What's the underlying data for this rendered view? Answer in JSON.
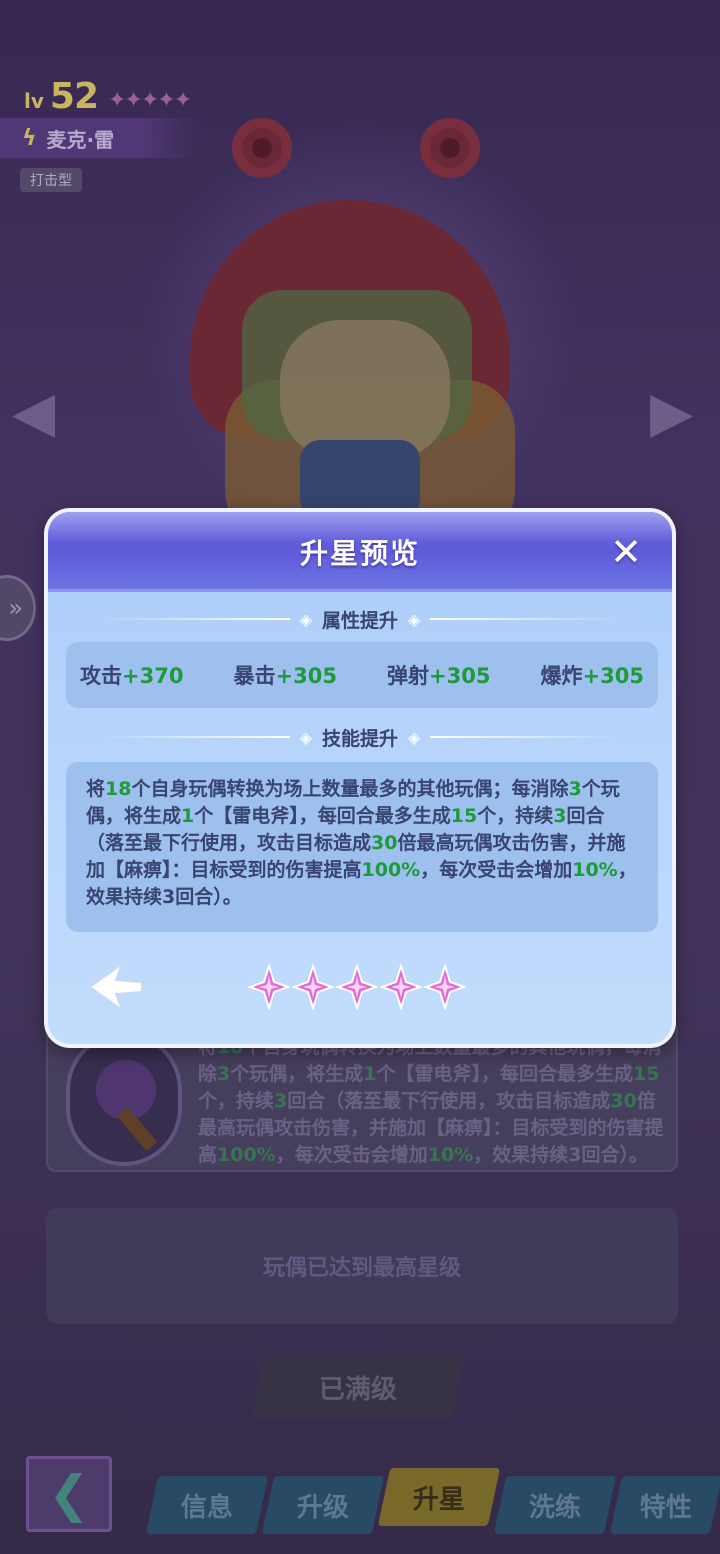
{
  "character": {
    "level_label": "lv",
    "level": "52",
    "name": "麦克·雷",
    "type": "打击型",
    "stars": "✦✦✦✦✦"
  },
  "skill_card": {
    "text_parts": [
      {
        "t": "将",
        "h": false
      },
      {
        "t": "18",
        "h": true
      },
      {
        "t": "个自身玩偶转换为场上数量最多的其他玩偶，每消除",
        "h": false
      },
      {
        "t": "3",
        "h": true
      },
      {
        "t": "个玩偶，将生成",
        "h": false
      },
      {
        "t": "1",
        "h": true
      },
      {
        "t": "个【雷电斧】，每回合最多生成",
        "h": false
      },
      {
        "t": "15",
        "h": true
      },
      {
        "t": "个，持续",
        "h": false
      },
      {
        "t": "3",
        "h": true
      },
      {
        "t": "回合（落至最下行使用，攻击目标造成",
        "h": false
      },
      {
        "t": "30",
        "h": true
      },
      {
        "t": "倍最高玩偶攻击伤害，并施加【麻痹】：目标受到的伤害提高",
        "h": false
      },
      {
        "t": "100%",
        "h": true
      },
      {
        "t": "，每次受击会增加",
        "h": false
      },
      {
        "t": "10%",
        "h": true
      },
      {
        "t": "，效果持续3回合）。",
        "h": false
      }
    ]
  },
  "max_star_text": "玩偶已达到最高星级",
  "max_level_button": "已满级",
  "tabs": [
    {
      "label": "信息",
      "active": false
    },
    {
      "label": "升级",
      "active": false
    },
    {
      "label": "升星",
      "active": true
    },
    {
      "label": "洗练",
      "active": false
    },
    {
      "label": "特性",
      "active": false
    }
  ],
  "modal": {
    "title": "升星预览",
    "close_icon": "close-x-icon",
    "attr_section": "属性提升",
    "attributes": [
      {
        "name": "攻击",
        "value": "+370"
      },
      {
        "name": "暴击",
        "value": "+305"
      },
      {
        "name": "弹射",
        "value": "+305"
      },
      {
        "name": "爆炸",
        "value": "+305"
      }
    ],
    "skill_section": "技能提升",
    "skill_parts": [
      {
        "t": "将",
        "h": false
      },
      {
        "t": "18",
        "h": true
      },
      {
        "t": "个自身玩偶转换为场上数量最多的其他玩偶；每消除",
        "h": false
      },
      {
        "t": "3",
        "h": true
      },
      {
        "t": "个玩偶，将生成",
        "h": false
      },
      {
        "t": "1",
        "h": true
      },
      {
        "t": "个【雷电斧】，每回合最多生成",
        "h": false
      },
      {
        "t": "15",
        "h": true
      },
      {
        "t": "个，持续",
        "h": false
      },
      {
        "t": "3",
        "h": true
      },
      {
        "t": "回合（落至最下行使用，攻击目标造成",
        "h": false
      },
      {
        "t": "30",
        "h": true
      },
      {
        "t": "倍最高玩偶攻击伤害，并施加【麻痹】：目标受到的伤害提高",
        "h": false
      },
      {
        "t": "100%",
        "h": true
      },
      {
        "t": "，每次受击会增加",
        "h": false
      },
      {
        "t": "10%",
        "h": true
      },
      {
        "t": "，效果持续3回合）。",
        "h": false
      }
    ],
    "star_count": 5,
    "colors": {
      "highlight": "#1d9a3a",
      "header": "#6f6ae6",
      "star": "#e06ad8"
    }
  }
}
